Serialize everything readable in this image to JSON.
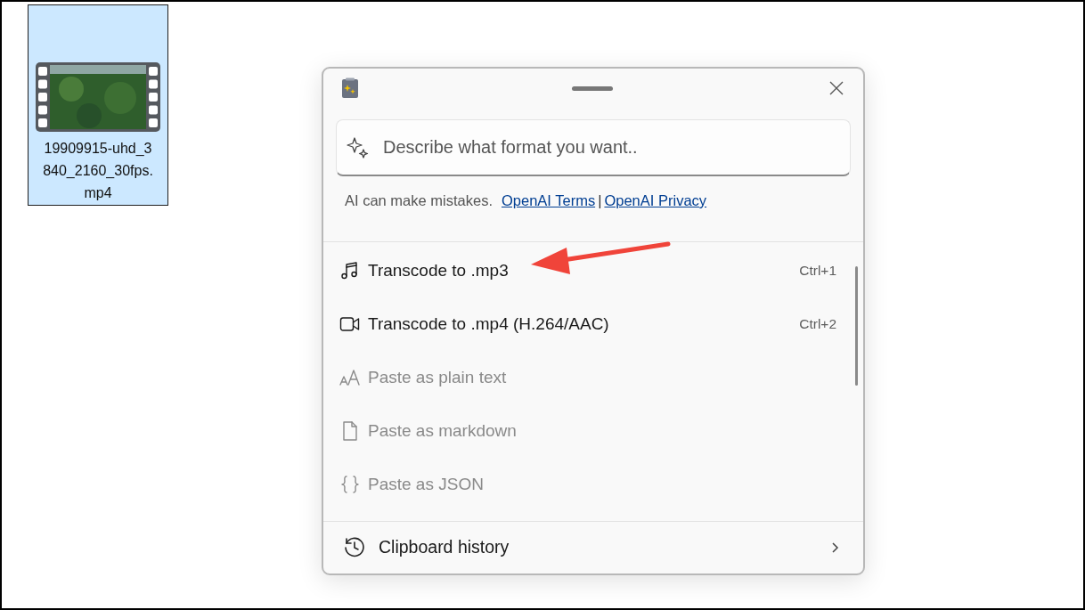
{
  "desktop_file": {
    "name": "19909915-uhd_3840_2160_30fps.mp4",
    "selected": true
  },
  "paste_dialog": {
    "search": {
      "placeholder": "Describe what format you want.."
    },
    "disclaimer": {
      "text": "AI can make mistakes.",
      "links": [
        "OpenAI Terms",
        "OpenAI Privacy"
      ],
      "separator": "|"
    },
    "items": [
      {
        "kind": "music",
        "label": "Transcode to .mp3",
        "shortcut": "Ctrl+1",
        "disabled": false
      },
      {
        "kind": "video",
        "label": "Transcode to .mp4 (H.264/AAC)",
        "shortcut": "Ctrl+2",
        "disabled": false
      },
      {
        "kind": "text",
        "label": "Paste as plain text",
        "disabled": true
      },
      {
        "kind": "document",
        "label": "Paste as markdown",
        "disabled": true
      },
      {
        "kind": "braces",
        "label": "Paste as JSON",
        "disabled": true
      }
    ],
    "footer": {
      "label": "Clipboard history"
    }
  }
}
